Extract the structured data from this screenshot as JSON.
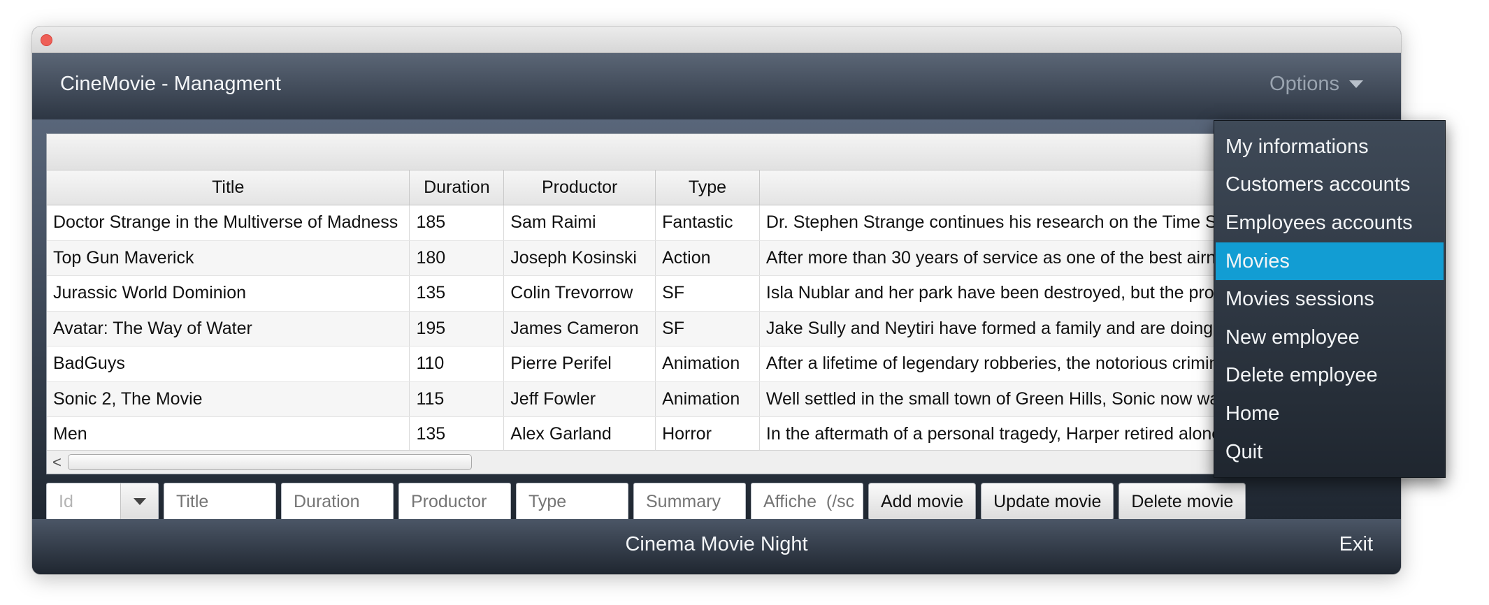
{
  "window": {
    "app_title": "CineMovie - Managment",
    "options_label": "Options"
  },
  "table": {
    "columns": [
      "Title",
      "Duration",
      "Productor",
      "Type",
      ""
    ],
    "rows": [
      [
        "Doctor Strange in the Multiverse of Madness",
        "185",
        "Sam Raimi",
        "Fantastic",
        "Dr. Stephen Strange continues his research on the Time S"
      ],
      [
        "Top Gun Maverick",
        "180",
        "Joseph Kosinski",
        "Action",
        "After more than 30 years of service as one of the best airn"
      ],
      [
        "Jurassic World Dominion",
        "135",
        "Colin Trevorrow",
        "SF",
        "Isla Nublar and her park have been destroyed, but the prob"
      ],
      [
        "Avatar: The Way of Water",
        "195",
        "James Cameron",
        "SF",
        "Jake Sully and Neytiri have formed a family and are doing"
      ],
      [
        "BadGuys",
        "110",
        "Pierre Perifel",
        "Animation",
        "After a lifetime of legendary robberies, the notorious crimin"
      ],
      [
        "Sonic 2, The Movie",
        "115",
        "Jeff Fowler",
        "Animation",
        "Well settled in the small town of Green Hills, Sonic now wa"
      ],
      [
        "Men",
        "135",
        "Alex Garland",
        "Horror",
        "In the aftermath of a personal tragedy, Harper retired alone"
      ]
    ],
    "scroll_left_glyph": "<"
  },
  "form": {
    "id_placeholder": "Id",
    "title_placeholder": "Title",
    "duration_placeholder": "Duration",
    "productor_placeholder": "Productor",
    "type_placeholder": "Type",
    "summary_placeholder": "Summary",
    "affiche_placeholder": "Affiche  (/sc",
    "add_label": "Add movie",
    "update_label": "Update movie",
    "delete_label": "Delete movie"
  },
  "footer": {
    "title": "Cinema Movie Night",
    "exit_label": "Exit"
  },
  "menu": {
    "selected_index": 3,
    "items": [
      "My informations",
      "Customers accounts",
      "Employees accounts",
      "Movies",
      "Movies sessions",
      "New employee",
      "Delete employee",
      "Home",
      "Quit"
    ]
  },
  "colors": {
    "accent": "#129dd3",
    "close_button": "#ee5f57"
  }
}
